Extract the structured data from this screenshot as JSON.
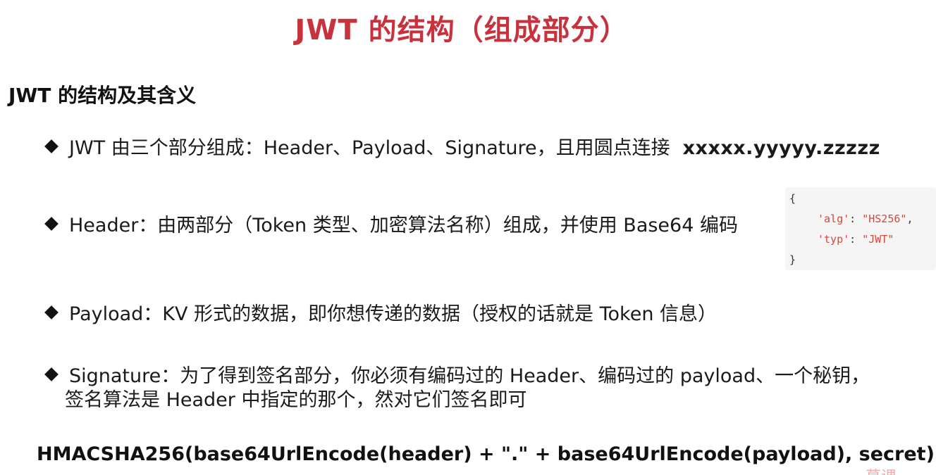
{
  "title": "JWT 的结构（组成部分）",
  "section_heading": "JWT 的结构及其含义",
  "bullets": [
    {
      "text": "JWT 由三个部分组成：Header、Payload、Signature，且用圆点连接",
      "format": "xxxxx.yyyyy.zzzzz"
    },
    {
      "text": "Header：由两部分（Token 类型、加密算法名称）组成，并使用 Base64 编码"
    },
    {
      "text": "Payload：KV 形式的数据，即你想传递的数据（授权的话就是 Token 信息）"
    },
    {
      "text": "Signature：为了得到签名部分，你必须有编码过的 Header、编码过的 payload、一个秘钥，",
      "text_cont": "签名算法是 Header 中指定的那个，然对它们签名即可"
    }
  ],
  "header_example": {
    "open": "{",
    "alg_key": "'alg'",
    "alg_value": "\"HS256\"",
    "typ_key": "'typ'",
    "typ_value": "\"JWT\"",
    "close": "}"
  },
  "formula": "HMACSHA256(base64UrlEncode(header) + \".\" + base64UrlEncode(payload), secret)",
  "watermark": "慕课"
}
